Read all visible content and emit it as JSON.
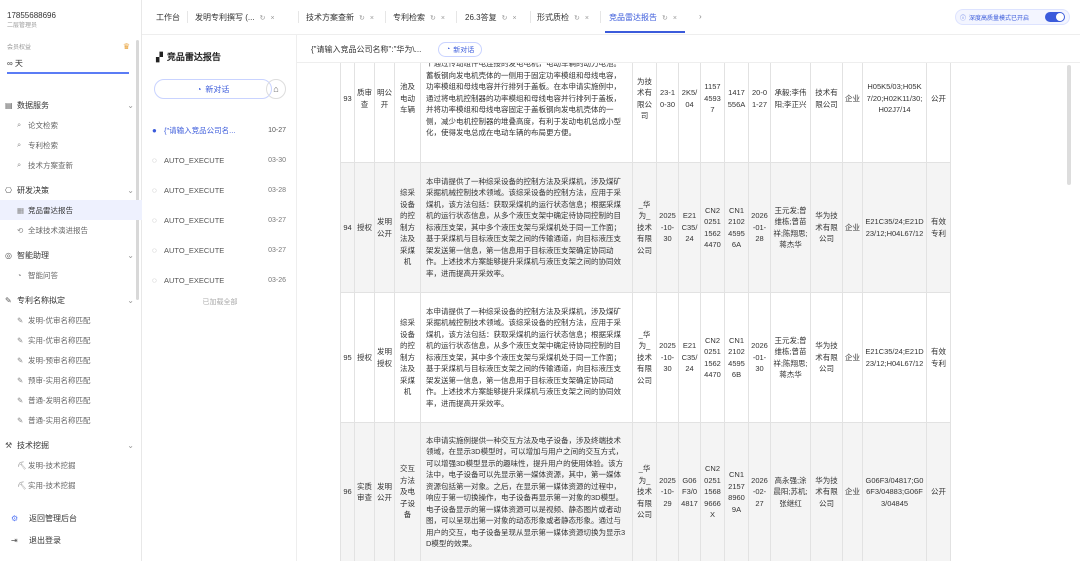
{
  "brand": {
    "phone": "17855688696",
    "subtitle": "二层管理员"
  },
  "vip": {
    "label": "会员权益",
    "crown": "♛",
    "days": "∞ 天"
  },
  "nav": {
    "groups": [
      {
        "label": "数据服务",
        "icon": "database-icon",
        "items": [
          {
            "label": "论文检索",
            "icon": "search-icon"
          },
          {
            "label": "专利检索",
            "icon": "search-icon"
          },
          {
            "label": "技术方案查新",
            "icon": "search-icon"
          }
        ]
      },
      {
        "label": "研发决策",
        "icon": "chart-icon",
        "items": [
          {
            "label": "竞品雷达报告",
            "icon": "document-icon"
          },
          {
            "label": "全球技术演进报告",
            "icon": "link-icon"
          }
        ]
      },
      {
        "label": "智能助理",
        "icon": "assistant-icon",
        "items": [
          {
            "label": "智能问答",
            "icon": "chat-icon"
          }
        ]
      },
      {
        "label": "专利名称拟定",
        "icon": "pen-icon",
        "items": [
          {
            "label": "发明-优审名称匹配",
            "icon": "pen-icon"
          },
          {
            "label": "实用-优审名称匹配",
            "icon": "pen-icon"
          },
          {
            "label": "发明-预审名称匹配",
            "icon": "pen-icon"
          },
          {
            "label": "预审-实用名称匹配",
            "icon": "pen-icon"
          },
          {
            "label": "普通-发明名称匹配",
            "icon": "pen-icon"
          },
          {
            "label": "普通-实用名称匹配",
            "icon": "pen-icon"
          }
        ]
      },
      {
        "label": "技术挖掘",
        "icon": "mining-icon",
        "items": [
          {
            "label": "发明-技术挖掘",
            "icon": "pick-icon"
          },
          {
            "label": "实用-技术挖掘",
            "icon": "pick-icon"
          }
        ]
      }
    ],
    "footer": [
      {
        "label": "返回管理后台",
        "icon": "gear-icon"
      },
      {
        "label": "退出登录",
        "icon": "logout-icon"
      }
    ]
  },
  "tabs": [
    {
      "label": "工作台",
      "closable": false
    },
    {
      "label": "发明专利撰写 (...",
      "closable": true
    },
    {
      "label": "技术方案查新",
      "closable": true
    },
    {
      "label": "专利检索",
      "closable": true
    },
    {
      "label": "26.3答复",
      "closable": true
    },
    {
      "label": "形式质检",
      "closable": true
    },
    {
      "label": "竞品雷达报告",
      "closable": true
    }
  ],
  "deep_mode": {
    "label": "深度高质量模式已开启"
  },
  "conv": {
    "title": "竞品雷达报告",
    "new_chat": "新对话",
    "items": [
      {
        "title": "{\"请输入竞品公司名...",
        "date": "10-27",
        "active": true
      },
      {
        "title": "AUTO_EXECUTE",
        "date": "03-30"
      },
      {
        "title": "AUTO_EXECUTE",
        "date": "03-28"
      },
      {
        "title": "AUTO_EXECUTE",
        "date": "03-27"
      },
      {
        "title": "AUTO_EXECUTE",
        "date": "03-27"
      },
      {
        "title": "AUTO_EXECUTE",
        "date": "03-26"
      }
    ],
    "loaded_all": "已加载全部"
  },
  "main": {
    "query": "{\"请输入竞品公司名称\":\"华为\\...",
    "new_chat": "新对话"
  },
  "table_rows": [
    {
      "no": "93",
      "status": "质审查",
      "type": "明公开",
      "title": "池及电动车辆",
      "abstract": "个通过传动组件电连接的发电电机，电动车辆的动力电池。蓄板钢向发电机壳体的一侧用于固定功率模组和母线电容，功率模组和母线电容并行排列于盖板。在本申请实施例中，通过将电机控制器的功率模组和母线电容并行排列于盖板，并将功率模组和母线电容固定于盖板钢向发电机壳体的一侧，减少电机控制器的堆叠高度，有利于发动电机总成小型化，使得发电总成在电动车辆的布局更方便。",
      "applicant": "为技术有限公司",
      "apply_date": "23-10-30",
      "pubno": "2K5/04",
      "appno": "115745937",
      "pn": "1417556A",
      "pub_date": "20-01-27",
      "inventor": "承毅;李伟阳;李正兴",
      "owner": "技术有限公司",
      "org": "企业",
      "ipc": "H05K5/03;H05K7/20;H02K11/30;H02J7/14",
      "legal": "公开",
      "gray": false
    },
    {
      "no": "94",
      "status": "授权",
      "type": "发明公开",
      "title": "综采设备的控制方法及采煤机",
      "abstract": "本申请提供了一种综采设备的控制方法及采煤机，涉及煤矿采掘机械控制技术领域。该综采设备的控制方法，应用于采煤机，该方法包括：获取采煤机的运行状态信息；根据采煤机的运行状态信息，从多个液压支架中确定待协同控制的目标液压支架，其中多个液压支架与采煤机处于同一工作面；基于采煤机与目标液压支架之间的传输通道，向目标液压支架发送第一信息，第一信息用于目标液压支架确定协同动作。上述技术方案能够提升采煤机与液压支架之间的协同效率，进而提高开采效率。",
      "applicant": "_华为_技术有限公司",
      "apply_date": "2025-10-30",
      "pubno": "E21C35/24",
      "appno": "CN2025115624470",
      "pn": "CN1210245956A",
      "pub_date": "2026-01-28",
      "inventor": "王元发;曾维栋;曾苗祥;陈翔思;蒋杰华",
      "owner": "华为技术有限公司",
      "org": "企业",
      "ipc": "E21C35/24;E21D23/12;H04L67/12",
      "legal": "有效专利",
      "gray": true
    },
    {
      "no": "95",
      "status": "授权",
      "type": "发明授权",
      "title": "综采设备的控制方法及采煤机",
      "abstract": "本申请提供了一种综采设备的控制方法及采煤机，涉及煤矿采掘机械控制技术领域。该综采设备的控制方法，应用于采煤机，该方法包括：获取采煤机的运行状态信息；根据采煤机的运行状态信息，从多个液压支架中确定待协同控制的目标液压支架，其中多个液压支架与采煤机处于同一工作面；基于采煤机与目标液压支架之间的传输通道，向目标液压支架发送第一信息，第一信息用于目标液压支架确定协同动作。上述技术方案能够提升采煤机与液压支架之间的协同效率，进而提高开采效率。",
      "applicant": "_华为_技术有限公司",
      "apply_date": "2025-10-30",
      "pubno": "E21C35/24",
      "appno": "CN2025115624470",
      "pn": "CN1210245956B",
      "pub_date": "2026-01-30",
      "inventor": "王元发;曾维栋;曾苗祥;陈翔思;蒋杰华",
      "owner": "华为技术有限公司",
      "org": "企业",
      "ipc": "E21C35/24;E21D23/12;H04L67/12",
      "legal": "有效专利",
      "gray": false
    },
    {
      "no": "96",
      "status": "实质审查",
      "type": "发明公开",
      "title": "交互方法及电子设备",
      "abstract": "本申请实施例提供一种交互方法及电子设备，涉及终端技术领域，在显示3D模型时，可以增加与用户之间的交互方式，可以增强3D模型显示的趣味性，提升用户的使用体验。该方法中，电子设备可以先显示第一媒体资源，其中，第一媒体资源包括第一对象。之后，在显示第一媒体资源的过程中，响应于第一切换操作，电子设备再显示第一对象的3D模型。电子设备显示的第一媒体资源可以是视频、静态图片或者动图，可以呈现出第一对象的动态形象或者静态形象。通过与用户的交互，电子设备呈现从显示第一媒体资源切换为显示3D模型的效果。",
      "applicant": "_华为_技术有限公司",
      "apply_date": "2025-10-29",
      "pubno": "G06F3/04817",
      "appno": "CN2025115689666X",
      "pn": "CN1215789609A",
      "pub_date": "2026-02-27",
      "inventor": "高永强;涂晨阳;苏机;张继红",
      "owner": "华为技术有限公司",
      "org": "企业",
      "ipc": "G06F3/04817;G06F3/04883;G06F3/04845",
      "legal": "公开",
      "gray": true
    }
  ]
}
